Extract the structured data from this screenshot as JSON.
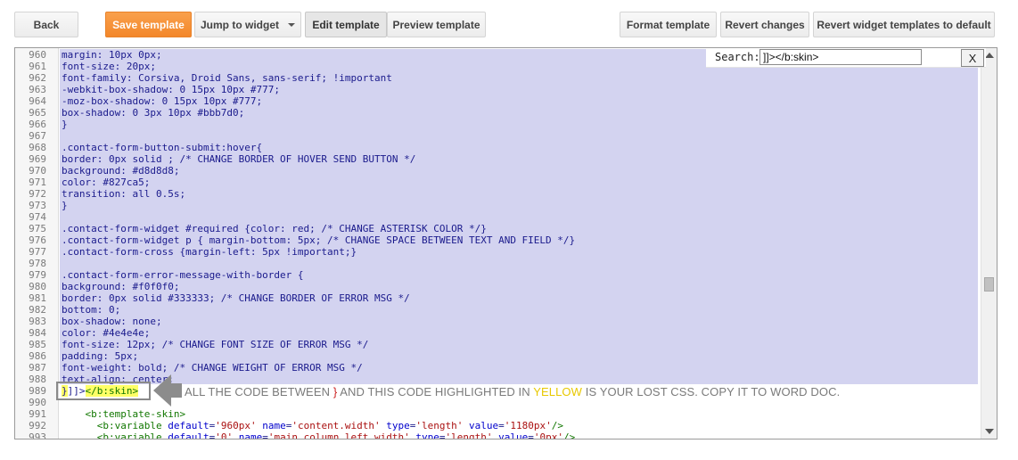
{
  "toolbar": {
    "back": "Back",
    "save_template": "Save template",
    "jump_to_widget": "Jump to widget",
    "edit_template": "Edit template",
    "preview_template": "Preview template",
    "format_template": "Format template",
    "revert_changes": "Revert changes",
    "revert_widget_templates": "Revert widget templates to default"
  },
  "search": {
    "label": "Search:",
    "value": "]]></b:skin>",
    "close": "X"
  },
  "editor": {
    "lines": [
      {
        "n": "960",
        "text": "margin: 10px 0px;"
      },
      {
        "n": "961",
        "text": "font-size: 20px;"
      },
      {
        "n": "962",
        "text": "font-family: Corsiva, Droid Sans, sans-serif; !important"
      },
      {
        "n": "963",
        "text": "-webkit-box-shadow: 0 15px 10px #777;"
      },
      {
        "n": "964",
        "text": "-moz-box-shadow: 0 15px 10px #777;"
      },
      {
        "n": "965",
        "text": "box-shadow: 0 3px 10px #bbb7d0;"
      },
      {
        "n": "966",
        "text": "}"
      },
      {
        "n": "967",
        "text": ""
      },
      {
        "n": "968",
        "text": ".contact-form-button-submit:hover{"
      },
      {
        "n": "969",
        "text": "border: 0px solid ; /* CHANGE BORDER OF HOVER SEND BUTTON */"
      },
      {
        "n": "970",
        "text": "background: #d8d8d8;"
      },
      {
        "n": "971",
        "text": "color: #827ca5;"
      },
      {
        "n": "972",
        "text": "transition: all 0.5s;"
      },
      {
        "n": "973",
        "text": "}"
      },
      {
        "n": "974",
        "text": ""
      },
      {
        "n": "975",
        "text": ".contact-form-widget #required {color: red; /* CHANGE ASTERISK COLOR */}"
      },
      {
        "n": "976",
        "text": ".contact-form-widget p { margin-bottom: 5px; /* CHANGE SPACE BETWEEN TEXT AND FIELD */}"
      },
      {
        "n": "977",
        "text": ".contact-form-cross {margin-left: 5px !important;}"
      },
      {
        "n": "978",
        "text": ""
      },
      {
        "n": "979",
        "text": ".contact-form-error-message-with-border {"
      },
      {
        "n": "980",
        "text": "background: #f0f0f0;"
      },
      {
        "n": "981",
        "text": "border: 0px solid #333333; /* CHANGE BORDER OF ERROR MSG */"
      },
      {
        "n": "982",
        "text": "bottom: 0;"
      },
      {
        "n": "983",
        "text": "box-shadow: none;"
      },
      {
        "n": "984",
        "text": "color: #4e4e4e;"
      },
      {
        "n": "985",
        "text": "font-size: 12px; /* CHANGE FONT SIZE OF ERROR MSG */"
      },
      {
        "n": "986",
        "text": "padding: 5px;"
      },
      {
        "n": "987",
        "text": "font-weight: bold; /* CHANGE WEIGHT OF ERROR MSG */"
      },
      {
        "n": "988",
        "text": "text-align: center;"
      },
      {
        "n": "989",
        "brace": "}",
        "close": "]]>",
        "tag": "</b:skin>"
      },
      {
        "n": "990",
        "text": ""
      },
      {
        "n": "991",
        "indent": "    ",
        "tag": "<b:template-skin>"
      },
      {
        "n": "992",
        "indent": "      ",
        "tag": "<b:variable",
        "attrs": [
          {
            "name": "default",
            "value": "'960px'"
          },
          {
            "name": "name",
            "value": "'content.width'"
          },
          {
            "name": "type",
            "value": "'length'"
          },
          {
            "name": "value",
            "value": "'1180px'"
          }
        ],
        "end": "/>"
      },
      {
        "n": "993",
        "indent": "      ",
        "tag": "<b:variable",
        "attrs": [
          {
            "name": "default",
            "value": "'0'"
          },
          {
            "name": "name",
            "value": "'main.column.left.width'"
          },
          {
            "name": "type",
            "value": "'length'"
          },
          {
            "name": "value",
            "value": "'0px'"
          }
        ],
        "end": "/>"
      }
    ]
  },
  "annotation": {
    "part1": "ALL THE CODE BETWEEN",
    "brace": "}",
    "part2": "AND THIS CODE HIGHLIGHTED IN",
    "yellow_word": "YELLOW",
    "part3": "IS YOUR LOST CSS. COPY IT TO WORD DOC."
  },
  "colors": {
    "accent_orange": "#f3872a",
    "selection": "#d3d3f0",
    "bracket_highlight": "#ffff66",
    "annotation_yellow": "#e8c800",
    "annotation_red": "#cc2222"
  },
  "icons": {
    "jump_caret": "chevron-down-icon",
    "arrow": "left-arrow-icon"
  }
}
